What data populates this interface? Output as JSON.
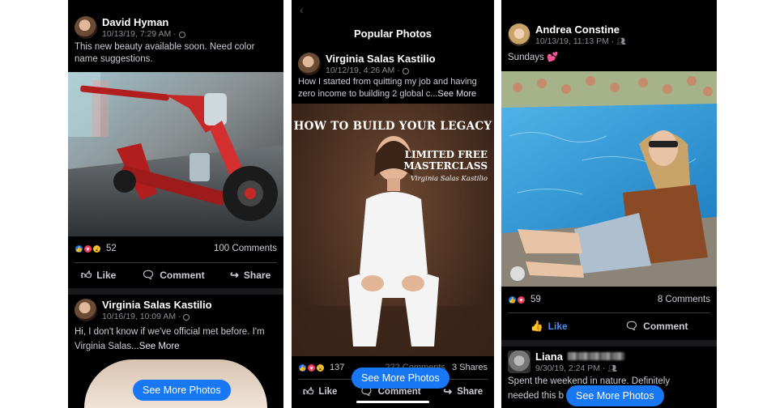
{
  "colors": {
    "accent": "#1877f2",
    "background": "#000000",
    "text_muted": "#8a8d91"
  },
  "panel1": {
    "post1": {
      "name": "David Hyman",
      "date": "10/13/19, 7:29 AM · ",
      "privacy_icon": "globe-icon",
      "text": "This new beauty available soon. Need color name suggestions.",
      "reactions_count": "52",
      "comments": "100 Comments",
      "like": "Like",
      "comment": "Comment",
      "share": "Share"
    },
    "post2": {
      "name": "Virginia Salas Kastilio",
      "date": "10/16/19, 10:09 AM · ",
      "privacy_icon": "globe-icon",
      "text": "Hi, I don't know if we've official met before. I'm Virginia Salas",
      "see_more": "...See More"
    },
    "see_more_photos": "See More Photos"
  },
  "panel2": {
    "title": "Popular Photos",
    "post": {
      "name": "Virginia Salas Kastilio",
      "date": "10/12/19, 4:26 AM · ",
      "privacy_icon": "globe-icon",
      "text": "How I started from quitting my job and having zero income to building 2 global c",
      "see_more": "...See More",
      "image_headline": "HOW TO BUILD YOUR LEGACY",
      "image_sub1": "LIMITED FREE",
      "image_sub2": "MASTERCLASS",
      "image_signature": "Virginia Salas Kastilio",
      "reactions_count": "137",
      "comments": "222 Comments",
      "shares": "3 Shares",
      "like": "Like",
      "comment": "Comment",
      "share": "Share"
    },
    "see_more_photos": "See More Photos"
  },
  "panel3": {
    "post1": {
      "name": "Andrea Constine",
      "date": "10/13/19, 11:13 PM · ",
      "privacy_icon": "friends-icon",
      "text": "Sundays 💕",
      "reactions_count": "59",
      "comments": "8 Comments",
      "like": "Like",
      "comment": "Comment"
    },
    "post2": {
      "name": "Liana",
      "date": "9/30/19, 2:24 PM · ",
      "privacy_icon": "friends-icon",
      "text_line1": "Spent the weekend in nature. Definitely",
      "text_line2": "needed this b"
    },
    "see_more_photos": "See More Photos"
  }
}
